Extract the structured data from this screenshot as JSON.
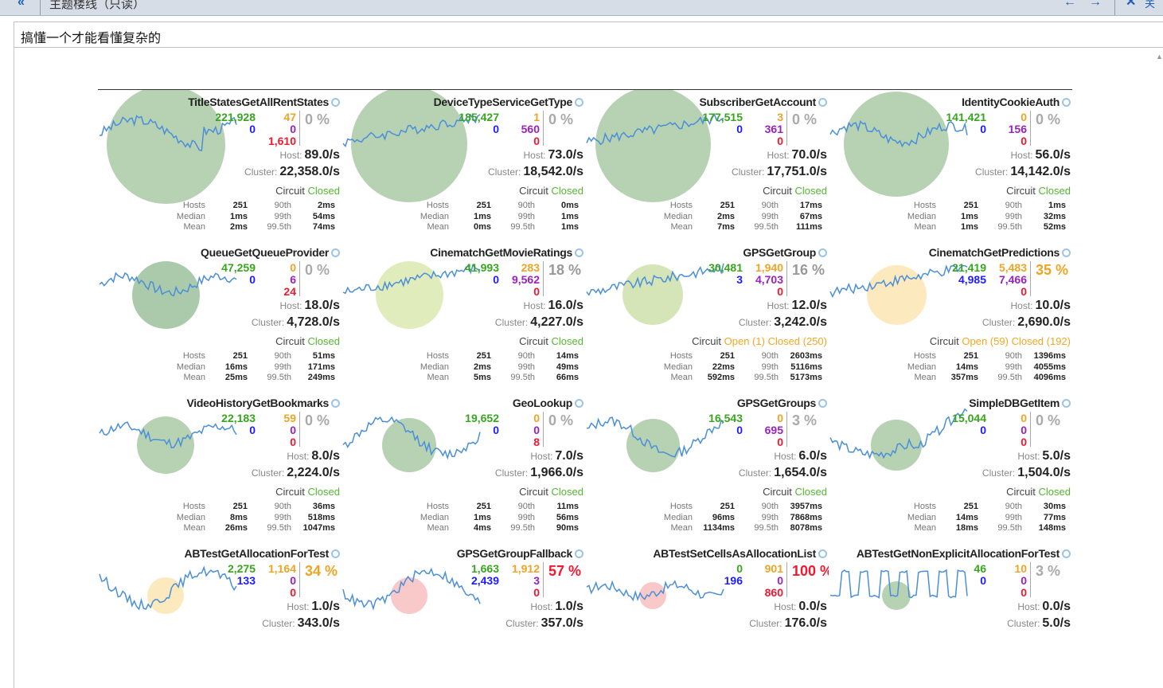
{
  "window": {
    "title": "主题楼线（只读）",
    "close_label": "关"
  },
  "mail": {
    "subject": "搞懂一个才能看懂复杂的"
  },
  "colors": {
    "success": "#38a51f",
    "short_circuited": "#1c1cff",
    "timeout": "#f0a424",
    "rejected": "#9b21c2",
    "failure": "#f31830",
    "circuit_closed": "#54b632",
    "circuit_open": "#f5a623",
    "sparkline": "#4a8fd8"
  },
  "labels": {
    "host": "Host:",
    "cluster": "Cluster:",
    "circuit": "Circuit",
    "closed": "Closed",
    "open": "Open",
    "hosts": "Hosts",
    "median": "Median",
    "mean": "Mean",
    "p90": "90th",
    "p99": "99th",
    "p995": "99.5th",
    "search_icon": "search-icon"
  },
  "commands": [
    {
      "name": "TitleStatesGetAllRentStates",
      "success": "221,928",
      "short": "0",
      "timeout": "47",
      "rejected": "0",
      "failure": "1,610",
      "error_pct": "0 %",
      "host_rate": "89.0/s",
      "cluster_rate": "22,358.0/s",
      "circuit": "closed",
      "circuit_open_text": "",
      "circuit_closed_text": "Closed",
      "hosts": "251",
      "median": "1ms",
      "mean": "2ms",
      "p90": "2ms",
      "p99": "54ms",
      "p995": "74ms",
      "circle_color": "#9ec39a",
      "circle_size": 0.99,
      "spark_trend": "volatile-high"
    },
    {
      "name": "DeviceTypeServiceGetType",
      "success": "185,427",
      "short": "0",
      "timeout": "1",
      "rejected": "560",
      "failure": "0",
      "error_pct": "0 %",
      "host_rate": "73.0/s",
      "cluster_rate": "18,542.0/s",
      "circuit": "closed",
      "circuit_open_text": "",
      "circuit_closed_text": "Closed",
      "hosts": "251",
      "median": "1ms",
      "mean": "0ms",
      "p90": "0ms",
      "p99": "1ms",
      "p995": "1ms",
      "circle_color": "#9ec39a",
      "circle_size": 0.97,
      "spark_trend": "rising"
    },
    {
      "name": "SubscriberGetAccount",
      "success": "177,515",
      "short": "0",
      "timeout": "3",
      "rejected": "361",
      "failure": "0",
      "error_pct": "0 %",
      "host_rate": "70.0/s",
      "cluster_rate": "17,751.0/s",
      "circuit": "closed",
      "circuit_open_text": "",
      "circuit_closed_text": "Closed",
      "hosts": "251",
      "median": "2ms",
      "mean": "7ms",
      "p90": "17ms",
      "p99": "67ms",
      "p995": "111ms",
      "circle_color": "#9ec39a",
      "circle_size": 0.96,
      "spark_trend": "rising"
    },
    {
      "name": "IdentityCookieAuth",
      "success": "141,421",
      "short": "0",
      "timeout": "0",
      "rejected": "156",
      "failure": "0",
      "error_pct": "0 %",
      "host_rate": "56.0/s",
      "cluster_rate": "14,142.0/s",
      "circuit": "closed",
      "circuit_open_text": "",
      "circuit_closed_text": "Closed",
      "hosts": "251",
      "median": "1ms",
      "mean": "1ms",
      "p90": "1ms",
      "p99": "32ms",
      "p995": "52ms",
      "circle_color": "#9ec39a",
      "circle_size": 0.86,
      "spark_trend": "volatile"
    },
    {
      "name": "QueueGetQueueProvider",
      "success": "47,259",
      "short": "0",
      "timeout": "0",
      "rejected": "6",
      "failure": "24",
      "error_pct": "0 %",
      "host_rate": "18.0/s",
      "cluster_rate": "4,728.0/s",
      "circuit": "closed",
      "circuit_open_text": "",
      "circuit_closed_text": "Closed",
      "hosts": "251",
      "median": "16ms",
      "mean": "25ms",
      "p90": "51ms",
      "p99": "171ms",
      "p995": "249ms",
      "circle_color": "#8fb88f",
      "circle_size": 0.5,
      "spark_trend": "volatile"
    },
    {
      "name": "CinematchGetMovieRatings",
      "success": "41,993",
      "short": "0",
      "timeout": "283",
      "rejected": "9,562",
      "failure": "0",
      "error_pct": "18 %",
      "host_rate": "16.0/s",
      "cluster_rate": "4,227.0/s",
      "circuit": "closed",
      "circuit_open_text": "",
      "circuit_closed_text": "Closed",
      "hosts": "251",
      "median": "2ms",
      "mean": "5ms",
      "p90": "14ms",
      "p99": "49ms",
      "p995": "66ms",
      "circle_color": "#d6e6a6",
      "circle_size": 0.5,
      "spark_trend": "rising"
    },
    {
      "name": "GPSGetGroup",
      "success": "30,481",
      "short": "3",
      "timeout": "1,940",
      "rejected": "4,703",
      "failure": "0",
      "error_pct": "16 %",
      "host_rate": "12.0/s",
      "cluster_rate": "3,242.0/s",
      "circuit": "mixed",
      "circuit_open_text": "Open (1)",
      "circuit_closed_text": "Closed (250)",
      "hosts": "251",
      "median": "22ms",
      "mean": "592ms",
      "p90": "2603ms",
      "p99": "5116ms",
      "p995": "5173ms",
      "circle_color": "#c7dca0",
      "circle_size": 0.43,
      "spark_trend": "rising"
    },
    {
      "name": "CinematchGetPredictions",
      "success": "21,419",
      "short": "4,985",
      "timeout": "5,483",
      "rejected": "7,466",
      "failure": "0",
      "error_pct": "35 %",
      "host_rate": "10.0/s",
      "cluster_rate": "2,690.0/s",
      "circuit": "mixed",
      "circuit_open_text": "Open (59)",
      "circuit_closed_text": "Closed (192)",
      "hosts": "251",
      "median": "14ms",
      "mean": "357ms",
      "p90": "1396ms",
      "p99": "4055ms",
      "p995": "4096ms",
      "circle_color": "#fce1a8",
      "circle_size": 0.42,
      "spark_trend": "rising"
    },
    {
      "name": "VideoHistoryGetBookmarks",
      "success": "22,183",
      "short": "0",
      "timeout": "59",
      "rejected": "0",
      "failure": "0",
      "error_pct": "0 %",
      "host_rate": "8.0/s",
      "cluster_rate": "2,224.0/s",
      "circuit": "closed",
      "circuit_open_text": "",
      "circuit_closed_text": "Closed",
      "hosts": "251",
      "median": "8ms",
      "mean": "26ms",
      "p90": "36ms",
      "p99": "518ms",
      "p995": "1047ms",
      "circle_color": "#9ec39a",
      "circle_size": 0.4,
      "spark_trend": "volatile"
    },
    {
      "name": "GeoLookup",
      "success": "19,652",
      "short": "0",
      "timeout": "0",
      "rejected": "0",
      "failure": "8",
      "error_pct": "0 %",
      "host_rate": "7.0/s",
      "cluster_rate": "1,966.0/s",
      "circuit": "closed",
      "circuit_open_text": "",
      "circuit_closed_text": "Closed",
      "hosts": "251",
      "median": "1ms",
      "mean": "4ms",
      "p90": "11ms",
      "p99": "56ms",
      "p995": "90ms",
      "circle_color": "#9ec39a",
      "circle_size": 0.37,
      "spark_trend": "wave"
    },
    {
      "name": "GPSGetGroups",
      "success": "16,543",
      "short": "0",
      "timeout": "0",
      "rejected": "695",
      "failure": "0",
      "error_pct": "3 %",
      "host_rate": "6.0/s",
      "cluster_rate": "1,654.0/s",
      "circuit": "closed",
      "circuit_open_text": "",
      "circuit_closed_text": "Closed",
      "hosts": "251",
      "median": "96ms",
      "mean": "1134ms",
      "p90": "3957ms",
      "p99": "7868ms",
      "p995": "8078ms",
      "circle_color": "#9ec39a",
      "circle_size": 0.36,
      "spark_trend": "wave"
    },
    {
      "name": "SimpleDBGetItem",
      "success": "15,044",
      "short": "0",
      "timeout": "0",
      "rejected": "0",
      "failure": "0",
      "error_pct": "0 %",
      "host_rate": "5.0/s",
      "cluster_rate": "1,504.0/s",
      "circuit": "closed",
      "circuit_open_text": "",
      "circuit_closed_text": "Closed",
      "hosts": "251",
      "median": "14ms",
      "mean": "18ms",
      "p90": "30ms",
      "p99": "77ms",
      "p995": "148ms",
      "circle_color": "#9ec39a",
      "circle_size": 0.34,
      "spark_trend": "valley-rise"
    },
    {
      "name": "ABTestGetAllocationForTest",
      "success": "2,275",
      "short": "133",
      "timeout": "1,164",
      "rejected": "0",
      "failure": "0",
      "error_pct": "34 %",
      "host_rate": "1.0/s",
      "cluster_rate": "343.0/s",
      "circuit": "mixed",
      "circuit_open_text": "",
      "circuit_closed_text": "",
      "hosts": "",
      "median": "",
      "mean": "",
      "p90": "",
      "p99": "",
      "p995": "",
      "circle_color": "#fce1a8",
      "circle_size": 0.2,
      "spark_trend": "wave"
    },
    {
      "name": "GPSGetGroupFallback",
      "success": "1,663",
      "short": "2,439",
      "timeout": "1,912",
      "rejected": "3",
      "failure": "0",
      "error_pct": "57 %",
      "host_rate": "1.0/s",
      "cluster_rate": "357.0/s",
      "circuit": "mixed",
      "circuit_open_text": "",
      "circuit_closed_text": "",
      "hosts": "",
      "median": "",
      "mean": "",
      "p90": "",
      "p99": "",
      "p995": "",
      "circle_color": "#f7b7b7",
      "circle_size": 0.2,
      "spark_trend": "wave"
    },
    {
      "name": "ABTestSetCellsAsAllocationList",
      "success": "0",
      "short": "196",
      "timeout": "901",
      "rejected": "0",
      "failure": "860",
      "error_pct": "100 %",
      "host_rate": "0.0/s",
      "cluster_rate": "176.0/s",
      "circuit": "mixed",
      "circuit_open_text": "",
      "circuit_closed_text": "",
      "hosts": "",
      "median": "",
      "mean": "",
      "p90": "",
      "p99": "",
      "p995": "",
      "circle_color": "#f7b7b7",
      "circle_size": 0.11,
      "spark_trend": "flat"
    },
    {
      "name": "ABTestGetNonExplicitAllocationForTest",
      "success": "46",
      "short": "0",
      "timeout": "10",
      "rejected": "0",
      "failure": "0",
      "error_pct": "3 %",
      "host_rate": "0.0/s",
      "cluster_rate": "5.0/s",
      "circuit": "closed",
      "circuit_open_text": "",
      "circuit_closed_text": "",
      "hosts": "",
      "median": "",
      "mean": "",
      "p90": "",
      "p99": "",
      "p995": "",
      "circle_color": "#9ec39a",
      "circle_size": 0.12,
      "spark_trend": "square"
    }
  ]
}
